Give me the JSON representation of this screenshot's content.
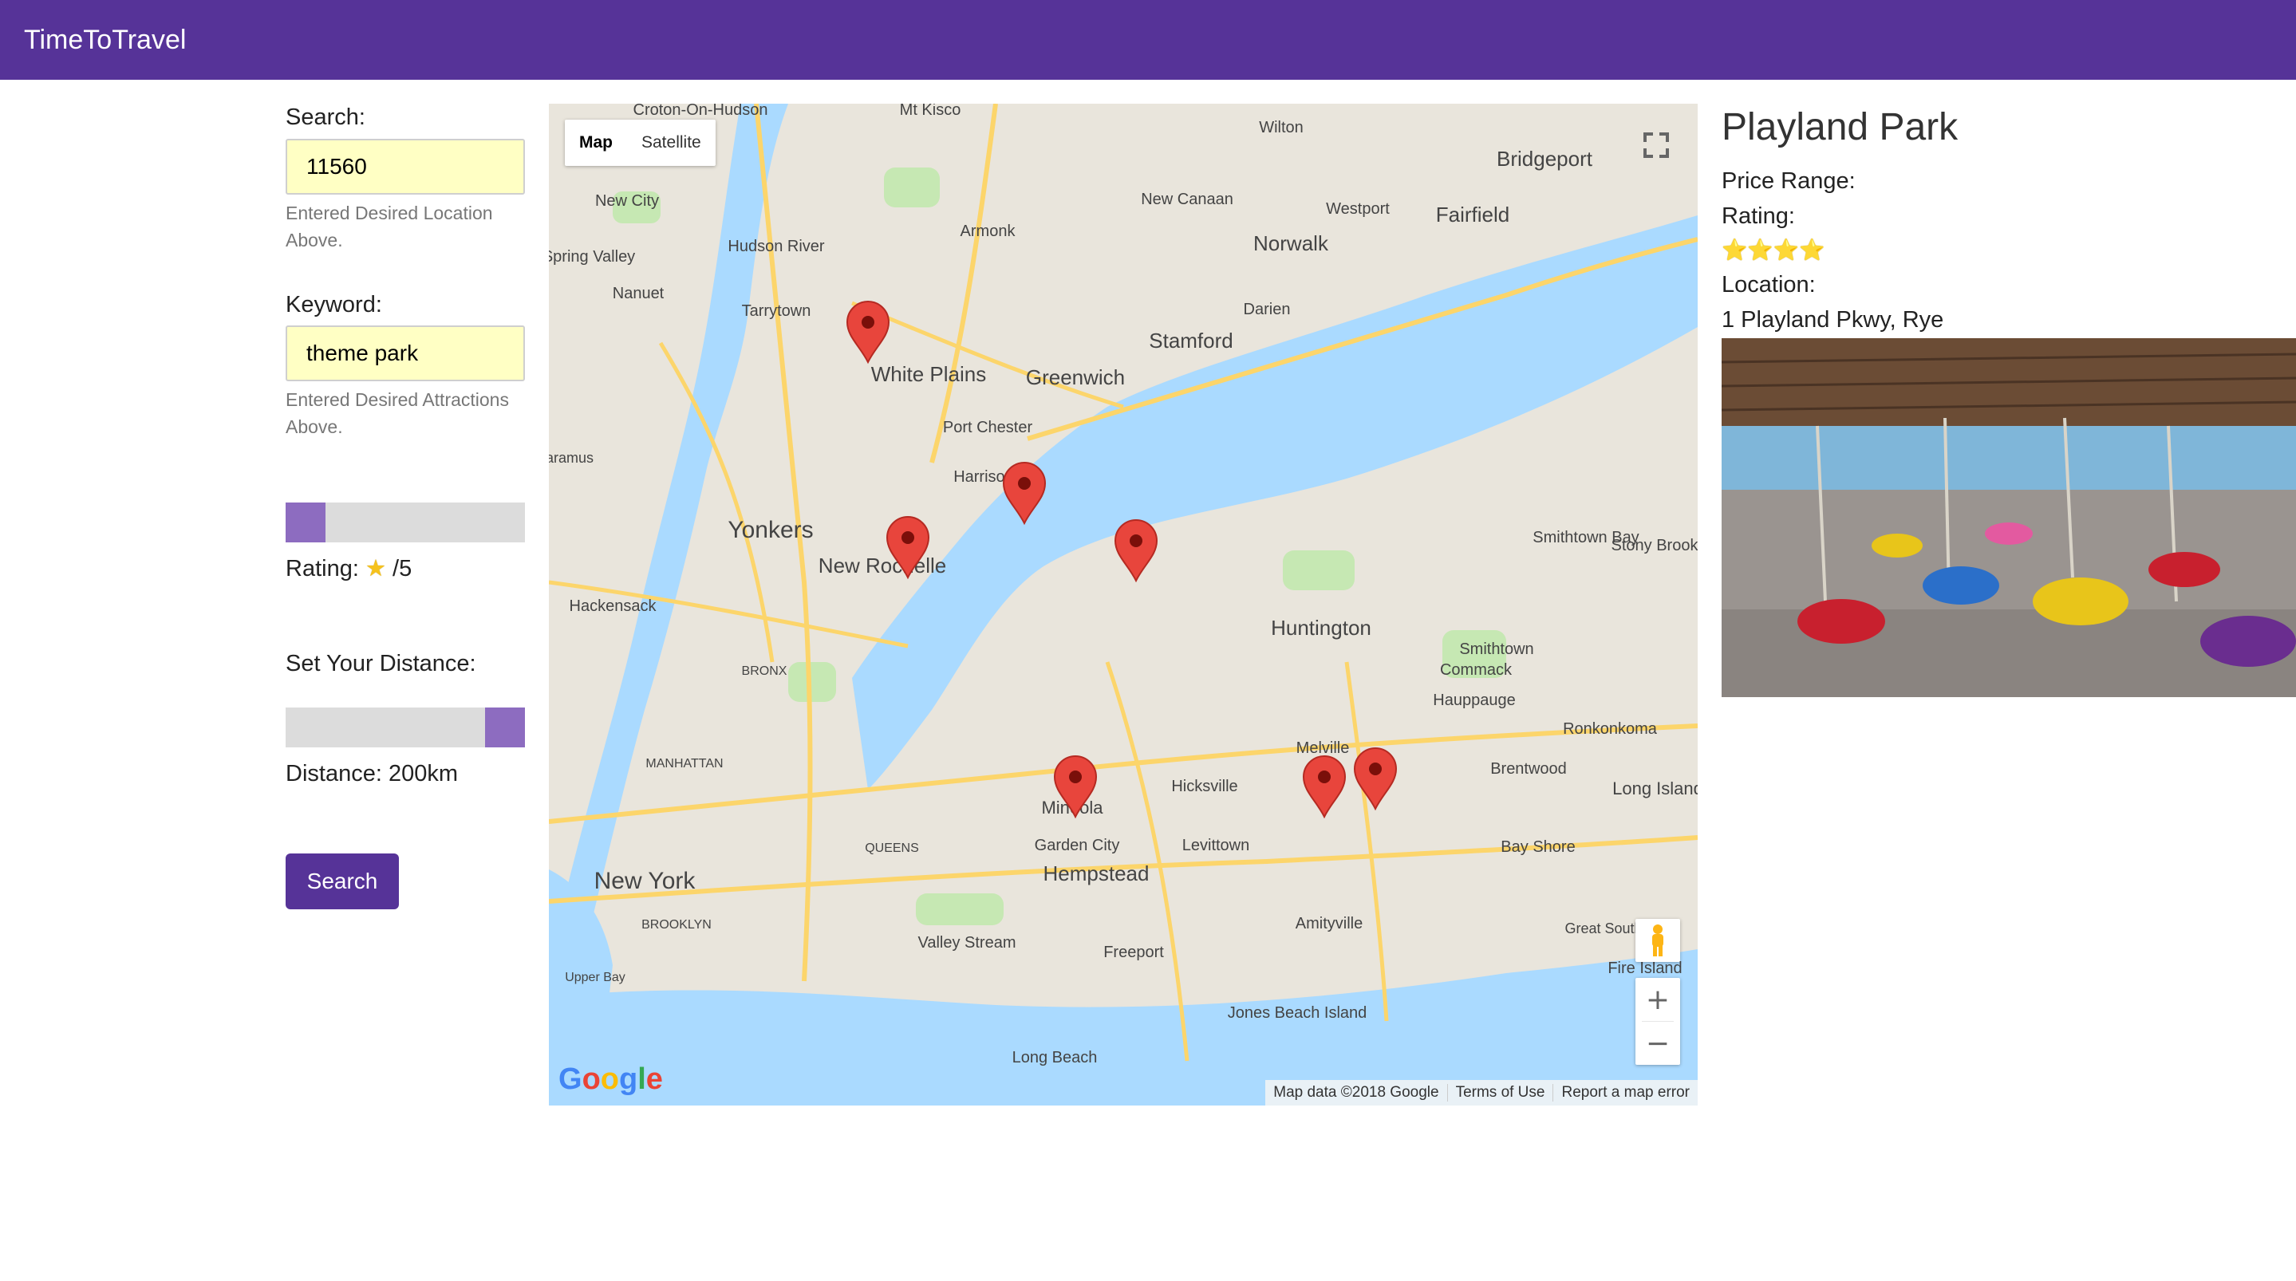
{
  "navbar": {
    "brand": "TimeToTravel"
  },
  "search": {
    "label": "Search:",
    "value": "11560",
    "help": "Entered Desired Location Above."
  },
  "keyword": {
    "label": "Keyword:",
    "value": "theme park",
    "help": "Entered Desired Attractions Above."
  },
  "rating_filter": {
    "label": "Rating:",
    "star": "★",
    "suffix": "/5",
    "slider_level": 0
  },
  "distance": {
    "label": "Set Your Distance:",
    "display": "Distance: 200km",
    "slider_level": 1
  },
  "search_button": {
    "label": "Search"
  },
  "map": {
    "type_buttons": [
      "Map",
      "Satellite"
    ],
    "active_type": "Map",
    "attribution": [
      "Map data ©2018 Google",
      "Terms of Use",
      "Report a map error"
    ],
    "logo": "Google",
    "marker_count": 7,
    "place_labels": [
      "Croton-On-Hudson",
      "Mt Kisco",
      "Wilton",
      "Bridgeport",
      "Fairfield",
      "New City",
      "New Canaan",
      "Westport",
      "Armonk",
      "Norwalk",
      "Spring Valley",
      "Nanuet",
      "Tarrytown",
      "Darien",
      "Stamford",
      "White Plains",
      "Greenwich",
      "Port Chester",
      "Harrison",
      "Yonkers",
      "New Rochelle",
      "Smithtown Bay",
      "Stony Brook",
      "Hackensack",
      "Huntington",
      "Smithtown",
      "BRONX",
      "Commack",
      "Hauppauge",
      "Ronkonkoma",
      "MANHATTAN",
      "Brentwood",
      "Long Island",
      "Hicksville",
      "Melville",
      "Mineola",
      "QUEENS",
      "Garden City",
      "Levittown",
      "Bay Shore",
      "New York",
      "Hempstead",
      "BROOKLYN",
      "Amityville",
      "Great South Bay",
      "Valley Stream",
      "Freeport",
      "Fire Island",
      "Jones Beach Island",
      "Long Beach",
      "Upper Bay",
      "Hudson River",
      "Paramus"
    ],
    "colors": {
      "water": "#aadaff",
      "land": "#e9e5dc",
      "road": "#fcd56b",
      "park": "#c6e8b3",
      "marker": "#e8453c"
    }
  },
  "detail": {
    "name": "Playland Park",
    "price_label": "Price Range:",
    "rating_label": "Rating:",
    "stars": "⭐⭐⭐⭐",
    "location_label": "Location:",
    "address": "1 Playland Pkwy, Rye",
    "photo_caption": "bumper cars"
  }
}
